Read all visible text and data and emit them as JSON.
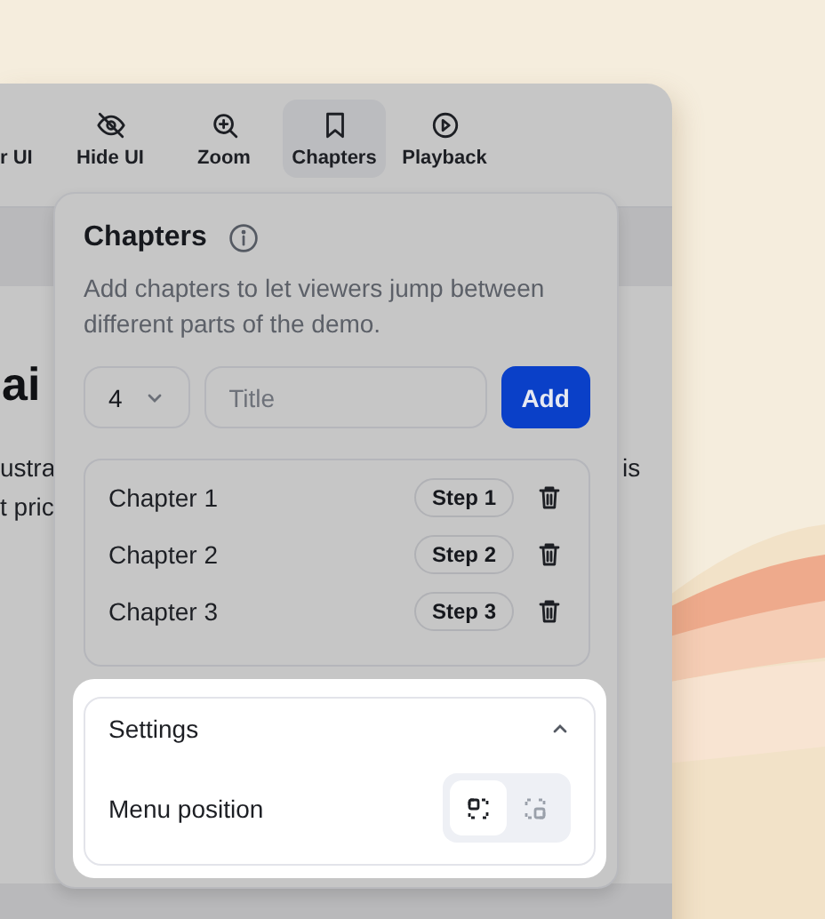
{
  "toolbar": {
    "items": [
      {
        "label": "r UI",
        "selected": false
      },
      {
        "label": "Hide UI",
        "selected": false
      },
      {
        "label": "Zoom",
        "selected": false
      },
      {
        "label": "Chapters",
        "selected": true
      },
      {
        "label": "Playback",
        "selected": false
      }
    ]
  },
  "page": {
    "heading": "ai",
    "body_lines": [
      "ustra",
      "t pric"
    ],
    "body_right": "is"
  },
  "chapters_popover": {
    "title": "Chapters",
    "description": "Add chapters to let viewers jump between different parts of the demo.",
    "step_select": {
      "value": "4"
    },
    "title_field": {
      "placeholder": "Title"
    },
    "add_button": "Add",
    "chapters": [
      {
        "title": "Chapter 1",
        "step": "Step 1"
      },
      {
        "title": "Chapter 2",
        "step": "Step 2"
      },
      {
        "title": "Chapter 3",
        "step": "Step 3"
      }
    ],
    "settings": {
      "title": "Settings",
      "expanded": true,
      "menu_position": {
        "label": "Menu position",
        "options": [
          {
            "selected": true
          },
          {
            "selected": false
          }
        ]
      }
    }
  }
}
